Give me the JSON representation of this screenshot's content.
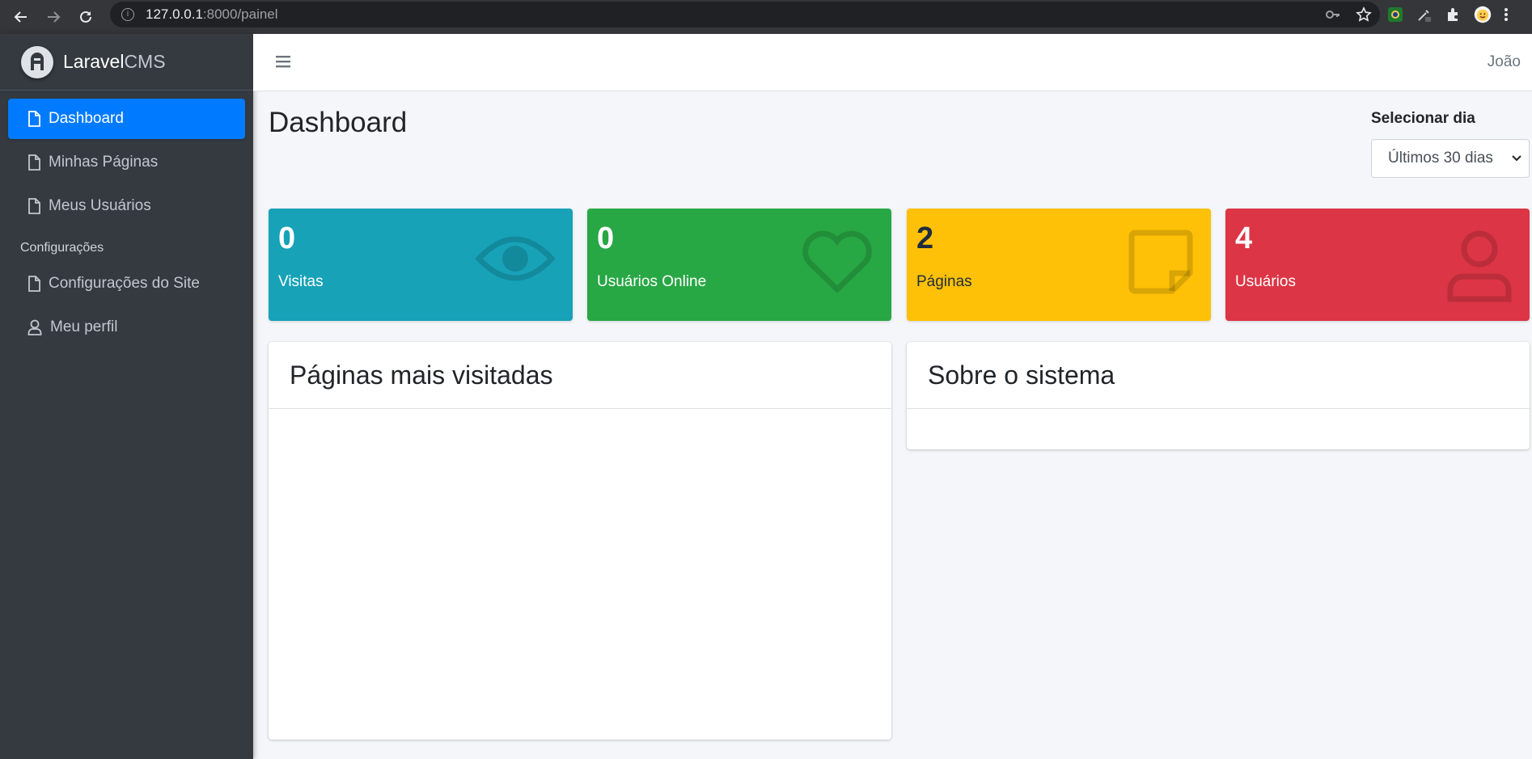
{
  "browser": {
    "url_host": "127.0.0.1",
    "url_rest": ":8000/painel"
  },
  "brand": {
    "name_bold": "Laravel",
    "name_light": "CMS"
  },
  "sidebar": {
    "items": [
      {
        "label": "Dashboard",
        "icon": "file-icon",
        "active": true
      },
      {
        "label": "Minhas Páginas",
        "icon": "file-icon"
      },
      {
        "label": "Meus Usuários",
        "icon": "file-icon"
      }
    ],
    "section_header": "Configurações",
    "settings_items": [
      {
        "label": "Configurações do Site",
        "icon": "file-icon"
      },
      {
        "label": "Meu perfil",
        "icon": "user-icon"
      }
    ]
  },
  "topbar": {
    "user_name": "João"
  },
  "page": {
    "title": "Dashboard"
  },
  "filter": {
    "label": "Selecionar dia",
    "selected": "Últimos 30 dias"
  },
  "stats": [
    {
      "value": "0",
      "label": "Visitas",
      "icon": "eye-icon",
      "color": "#17a2b8"
    },
    {
      "value": "0",
      "label": "Usuários Online",
      "icon": "heart-icon",
      "color": "#28a745"
    },
    {
      "value": "2",
      "label": "Páginas",
      "icon": "sticky-note-icon",
      "color": "#ffc107"
    },
    {
      "value": "4",
      "label": "Usuários",
      "icon": "user-icon",
      "color": "#dc3545"
    }
  ],
  "cards": {
    "most_visited_title": "Páginas mais visitadas",
    "about_title": "Sobre o sistema"
  }
}
